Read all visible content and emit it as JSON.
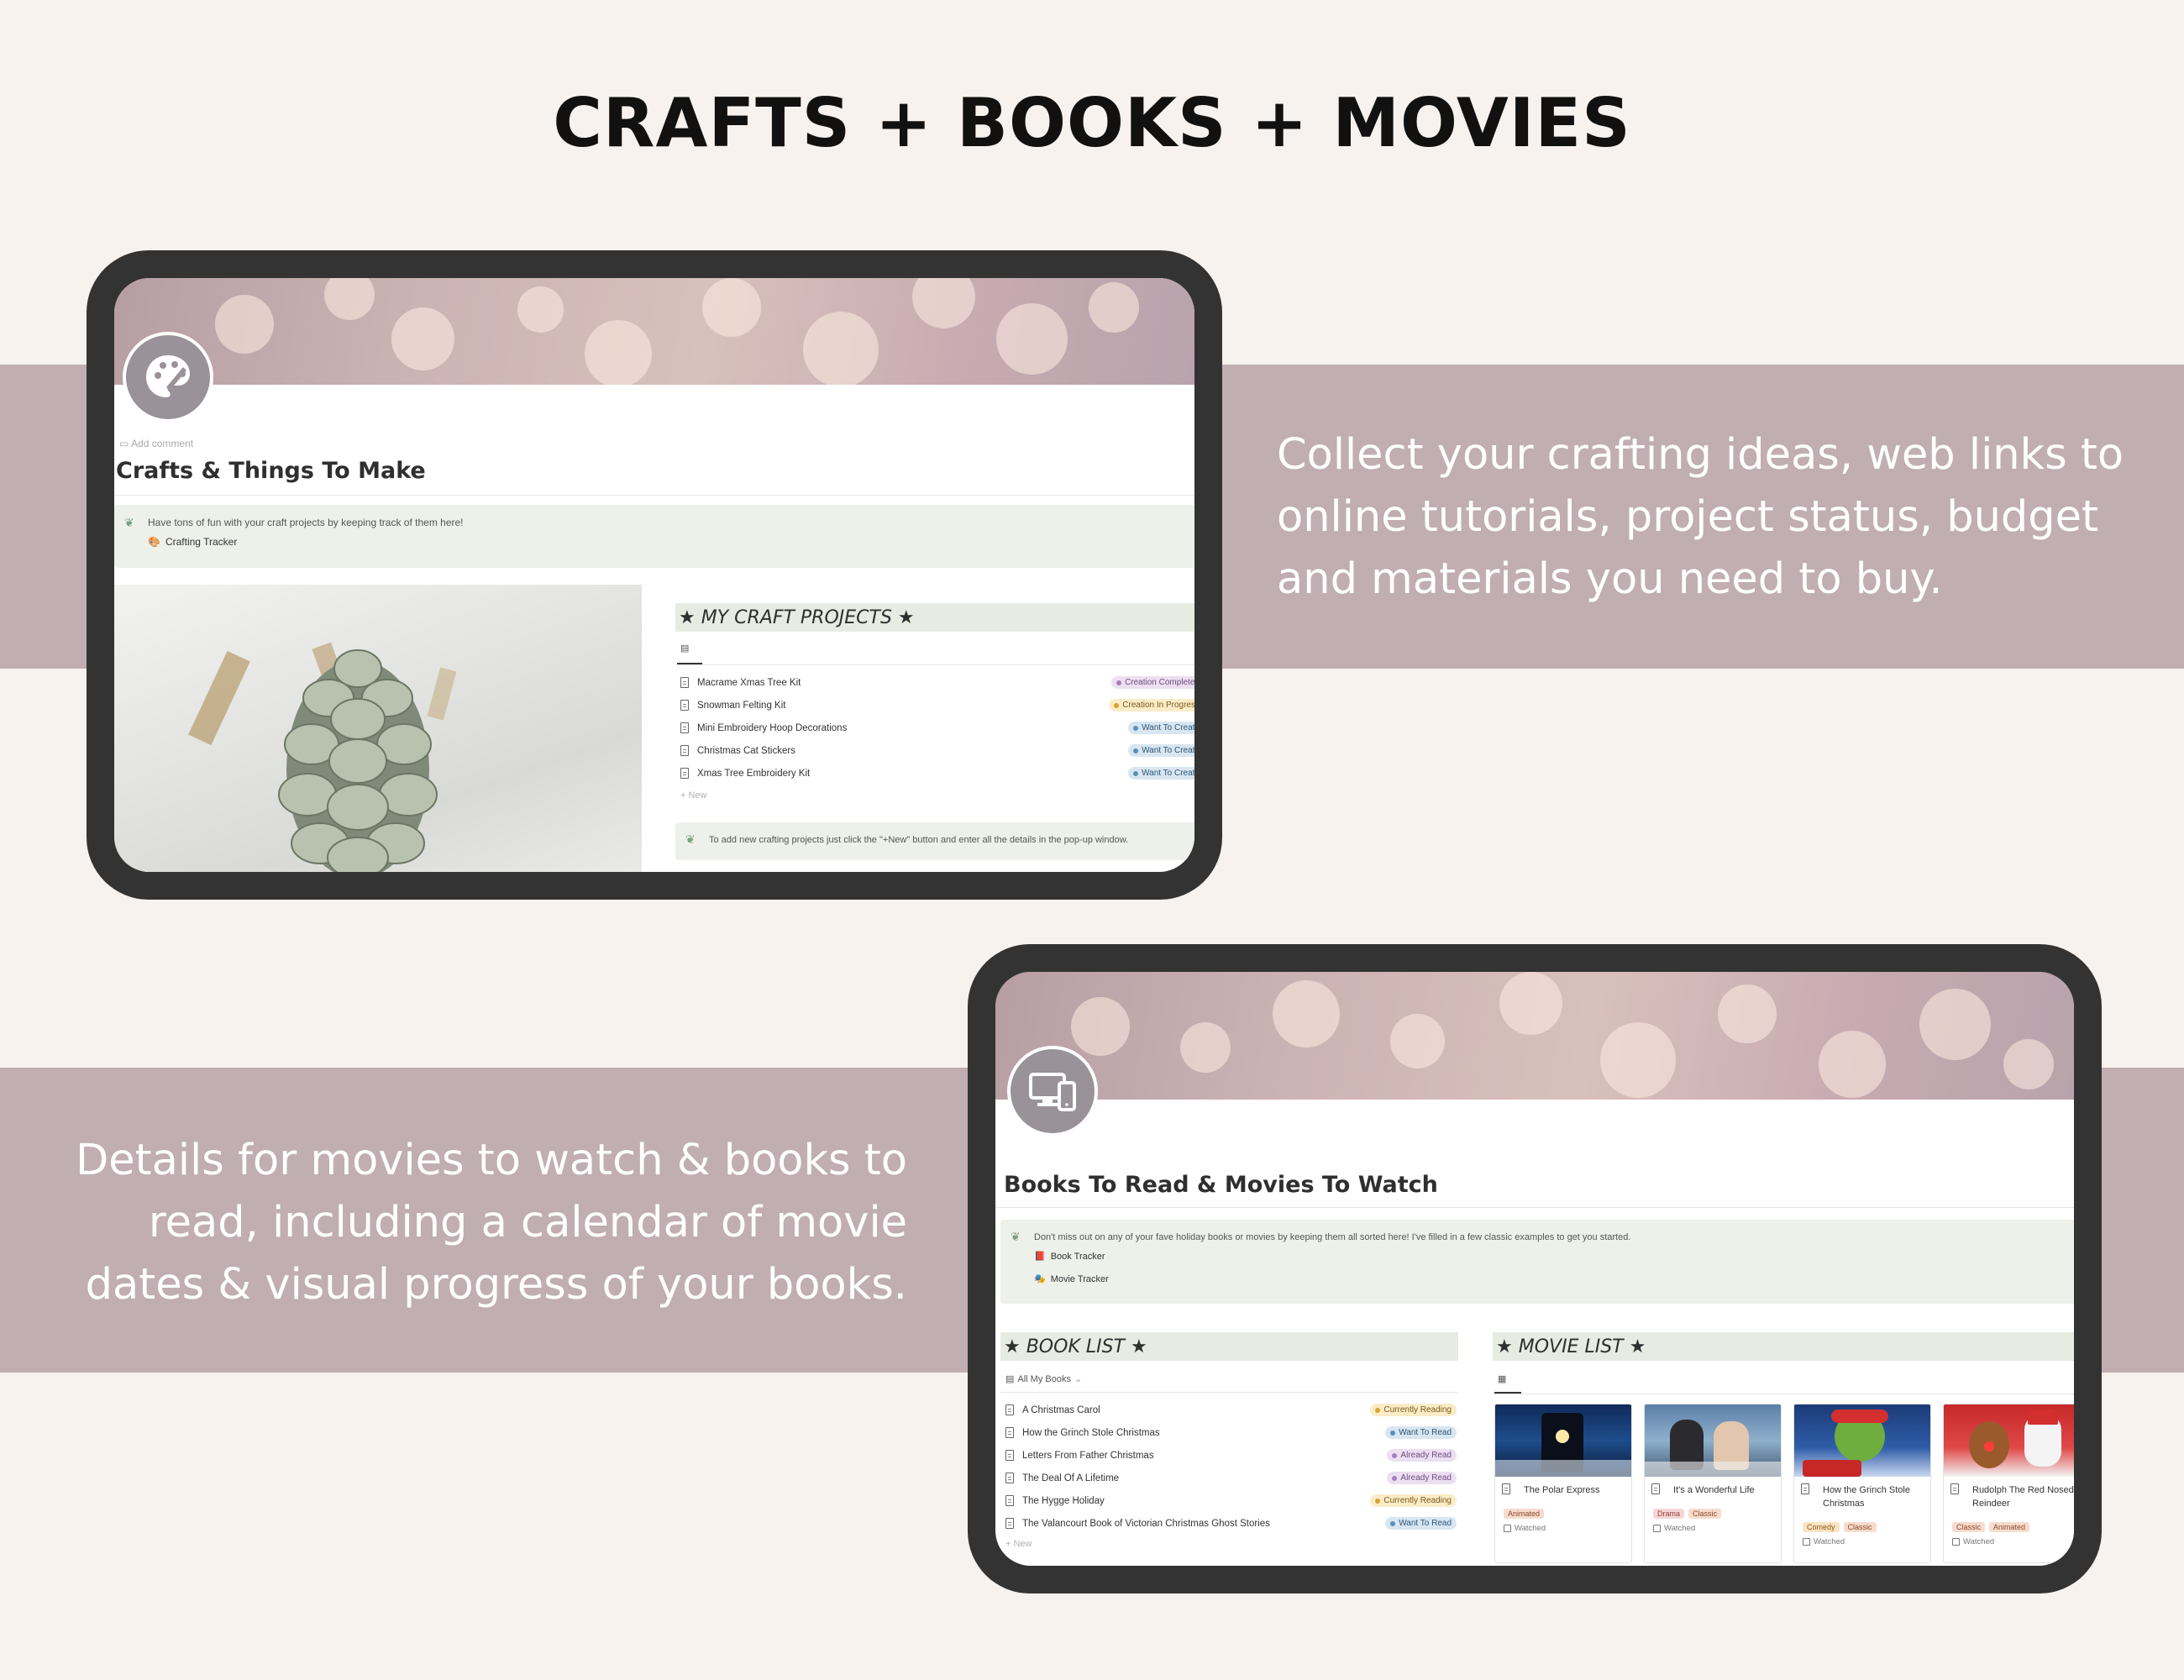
{
  "header": {
    "title": "CRAFTS + BOOKS + MOVIES"
  },
  "descriptions": {
    "crafts": "Collect your crafting ideas, web links to online tutorials, project status, budget and materials you need to buy.",
    "books_movies": "Details for movies to watch & books to read, including a calendar of movie dates & visual progress of your books."
  },
  "crafts_page": {
    "icon": "palette-icon",
    "add_comment": "Add comment",
    "title": "Crafts & Things To Make",
    "callout_text": "Have tons of fun with your craft projects by keeping track of them here!",
    "callout_link": "Crafting Tracker",
    "section_title": "★ MY CRAFT PROJECTS ★",
    "projects": [
      {
        "name": "Macrame Xmas Tree Kit",
        "status": "Creation Completed",
        "color": "purple"
      },
      {
        "name": "Snowman Felting Kit",
        "status": "Creation In Progress",
        "color": "yellow"
      },
      {
        "name": "Mini Embroidery Hoop Decorations",
        "status": "Want To Create",
        "color": "blue"
      },
      {
        "name": "Christmas Cat Stickers",
        "status": "Want To Create",
        "color": "blue"
      },
      {
        "name": "Xmas Tree Embroidery Kit",
        "status": "Want To Create",
        "color": "blue"
      }
    ],
    "new_label": "+ New",
    "tip": "To add new crafting projects just click the \"+New\" button and enter all the details in the pop-up window."
  },
  "media_page": {
    "icon": "devices-icon",
    "title": "Books To Read & Movies To Watch",
    "callout_text": "Don't miss out on any of your fave holiday books or movies by keeping them all sorted here! I've filled in a few classic examples to get you started.",
    "callout_links": [
      "Book Tracker",
      "Movie Tracker"
    ],
    "book_section_title": "★ BOOK LIST ★",
    "book_view": "All My Books",
    "books": [
      {
        "name": "A Christmas Carol",
        "status": "Currently Reading",
        "color": "yellow"
      },
      {
        "name": "How the Grinch Stole Christmas",
        "status": "Want To Read",
        "color": "blue"
      },
      {
        "name": "Letters From Father Christmas",
        "status": "Already Read",
        "color": "purple"
      },
      {
        "name": "The Deal Of A Lifetime",
        "status": "Already Read",
        "color": "purple"
      },
      {
        "name": "The Hygge Holiday",
        "status": "Currently Reading",
        "color": "yellow"
      },
      {
        "name": "The Valancourt Book of Victorian Christmas Ghost Stories",
        "status": "Want To Read",
        "color": "blue"
      }
    ],
    "new_label": "+ New",
    "movie_section_title": "★ MOVIE LIST ★",
    "watched_label": "Watched",
    "movies": [
      {
        "title": "The Polar Express",
        "tags": [
          "Animated"
        ]
      },
      {
        "title": "It's a Wonderful Life",
        "tags": [
          "Drama",
          "Classic"
        ]
      },
      {
        "title": "How the Grinch Stole Christmas",
        "tags": [
          "Comedy",
          "Classic"
        ]
      },
      {
        "title": "Rudolph The Red Nosed Reindeer",
        "tags": [
          "Classic",
          "Animated"
        ]
      }
    ]
  },
  "colors": {
    "background": "#f7f2ee",
    "band": "#c0aeb3",
    "tablet": "#333333",
    "callout": "#eef1ea",
    "badge_purple": "#ecdff1",
    "badge_yellow": "#fbecc8",
    "badge_blue": "#d8e6f1"
  }
}
